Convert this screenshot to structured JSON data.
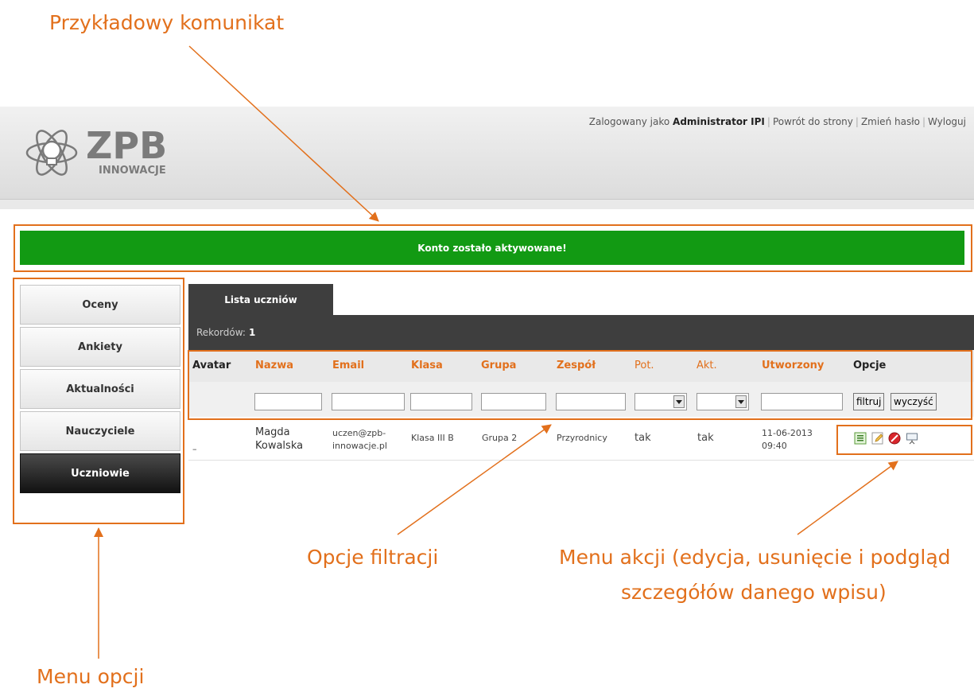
{
  "callouts": {
    "message": "Przykładowy komunikat",
    "filters": "Opcje filtracji",
    "actions_line1": "Menu akcji (edycja, usunięcie i podgląd",
    "actions_line2": "szczegółów danego wpisu)",
    "menu": "Menu opcji"
  },
  "colors": {
    "accent": "#e2701c",
    "banner": "#129a13",
    "dark": "#3e3e3e"
  },
  "logo": {
    "main": "ZPB",
    "sub": "INNOWACJE"
  },
  "topnav": {
    "logged_as_label": "Zalogowany jako",
    "user": "Administrator IPI",
    "back": "Powrót do strony",
    "change_password": "Zmień hasło",
    "logout": "Wyloguj"
  },
  "banner": {
    "text": "Konto zostało aktywowane!"
  },
  "sidebar": {
    "items": [
      {
        "label": "Oceny"
      },
      {
        "label": "Ankiety"
      },
      {
        "label": "Aktualności"
      },
      {
        "label": "Nauczyciele"
      },
      {
        "label": "Uczniowie"
      }
    ],
    "active": "Uczniowie"
  },
  "tab": {
    "label": "Lista uczniów"
  },
  "records": {
    "label": "Rekordów:",
    "count": "1"
  },
  "table": {
    "columns": [
      "Avatar",
      "Nazwa",
      "Email",
      "Klasa",
      "Grupa",
      "Zespół",
      "Pot.",
      "Akt.",
      "Utworzony",
      "Opcje"
    ],
    "filter_buttons": {
      "filter": "filtruj",
      "clear": "wyczyść"
    },
    "rows": [
      {
        "avatar": "–",
        "name_first": "Magda",
        "name_last": "Kowalska",
        "email_1": "uczen@zpb-",
        "email_2": "innowacje.pl",
        "class": "Klasa III B",
        "group": "Grupa 2",
        "team": "Przyrodnicy",
        "confirmed": "tak",
        "active": "tak",
        "created_date": "11-06-2013",
        "created_time": "09:40",
        "actions": [
          "list-details-icon",
          "edit-pencil-icon",
          "delete-forbidden-icon",
          "preview-presentation-icon"
        ]
      }
    ]
  }
}
